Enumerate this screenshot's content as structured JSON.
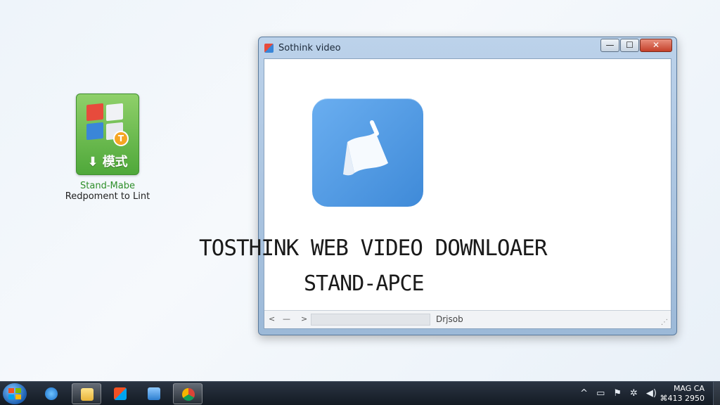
{
  "desktop_icon": {
    "tile_text": "模式",
    "badge": "T",
    "label_line1": "Stand-Mabe",
    "label_line2": "Redpoment to Lint"
  },
  "window": {
    "title": "Sothink video",
    "minimize": "—",
    "maximize": "☐",
    "close": "✕",
    "status_text": "Drjsob",
    "status_left": "<",
    "status_minus": "—",
    "status_right": ">",
    "grip": "⋰"
  },
  "headline": "TOSTHINK WEB VIDEO DOWNLOAER",
  "subline": "STAND-APCE",
  "taskbar": {
    "tray_up": "^",
    "clock_line1": "MAG CA",
    "clock_line2": "⌘413 2950"
  },
  "colors": {
    "desktop_green": "#4fa83a",
    "logo_blue": "#3f8ad8",
    "taskbar_dark": "#141b24",
    "close_red": "#c5402a"
  }
}
